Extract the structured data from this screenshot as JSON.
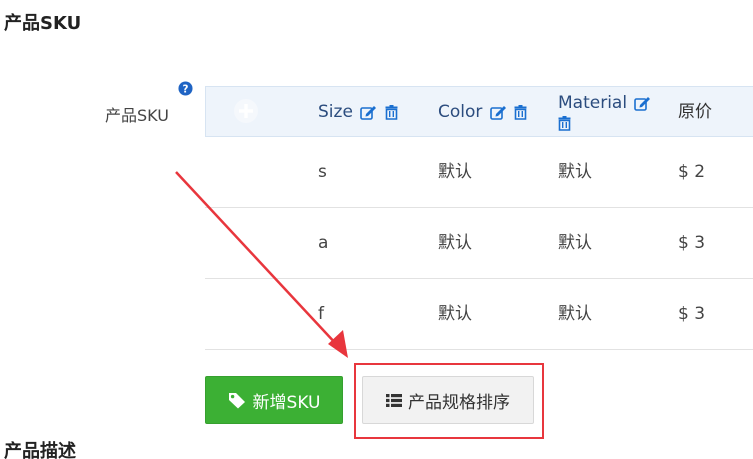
{
  "section": {
    "title": "产品SKU"
  },
  "field": {
    "label": "产品SKU",
    "help_icon": "question-circle-icon"
  },
  "table": {
    "headers": {
      "size": "Size",
      "color": "Color",
      "material": "Material",
      "price": "原价"
    },
    "rows": [
      {
        "size": "s",
        "color": "默认",
        "material": "默认",
        "price": "$ 2"
      },
      {
        "size": "a",
        "color": "默认",
        "material": "默认",
        "price": "$ 3"
      },
      {
        "size": "f",
        "color": "默认",
        "material": "默认",
        "price": "$ 3"
      }
    ]
  },
  "buttons": {
    "add_sku": "新增SKU",
    "sort_specs": "产品规格排序"
  },
  "next_section": {
    "title": "产品描述"
  },
  "colors": {
    "accent_green": "#3cb034",
    "header_blue": "#2b4c7e",
    "icon_blue": "#1a6fd0",
    "annotation_red": "#e8363d"
  }
}
